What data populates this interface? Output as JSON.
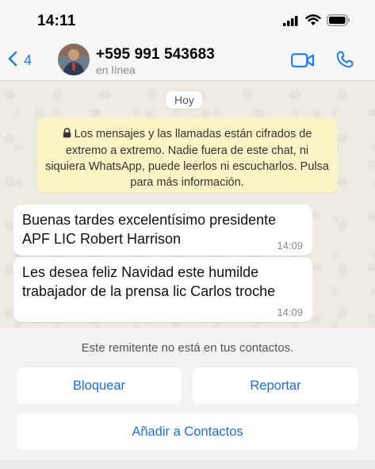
{
  "status_bar": {
    "time": "14:11",
    "icons": [
      "signal-icon",
      "wifi-icon",
      "battery-icon"
    ]
  },
  "header": {
    "back_count": "4",
    "contact_name": "+595 991 543683",
    "contact_status": "en línea",
    "icons": [
      "chevron-left-icon",
      "video-call-icon",
      "phone-icon"
    ],
    "accent_color": "#1d7ef0"
  },
  "chat": {
    "date_label": "Hoy",
    "encryption_notice": "Los mensajes y las llamadas están cifrados de extremo a extremo. Nadie fuera de este chat, ni siquiera WhatsApp, puede leerlos ni escucharlos. Pulsa para más información.",
    "messages": [
      {
        "text": "Buenas tardes excelentísimo presidente APF LIC Robert Harrison",
        "time": "14:09"
      },
      {
        "text": "Les desea feliz Navidad este humilde trabajador de la prensa lic Carlos troche",
        "time": "14:09"
      }
    ]
  },
  "unknown_sender": {
    "note": "Este remitente no está en tus contactos.",
    "block_label": "Bloquear",
    "report_label": "Reportar",
    "add_label": "Añadir a Contactos"
  }
}
